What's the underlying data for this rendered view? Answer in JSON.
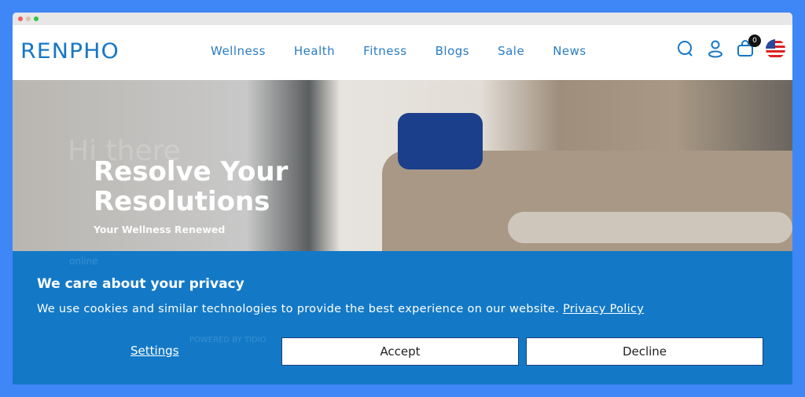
{
  "brand": "RENPHO",
  "nav": [
    "Wellness",
    "Health",
    "Fitness",
    "Blogs",
    "Sale",
    "News"
  ],
  "cart_count": "0",
  "icons": [
    "search-icon",
    "user-icon",
    "cart-icon",
    "us-flag-icon"
  ],
  "hero": {
    "title_line1": "Resolve Your",
    "title_line2": "Resolutions",
    "subtitle": "Your Wellness Renewed"
  },
  "chat_ghost": {
    "greeting": "Hi there",
    "status": "online",
    "powered": "POWERED BY TIDIO"
  },
  "cookie": {
    "title": "We care about your privacy",
    "text": "We use cookies and similar technologies to provide the best experience on our website.",
    "policy_link": "Privacy Policy",
    "settings": "Settings",
    "accept": "Accept",
    "decline": "Decline"
  },
  "colors": {
    "accent": "#1379c7",
    "page_bg": "#3f86f7"
  }
}
